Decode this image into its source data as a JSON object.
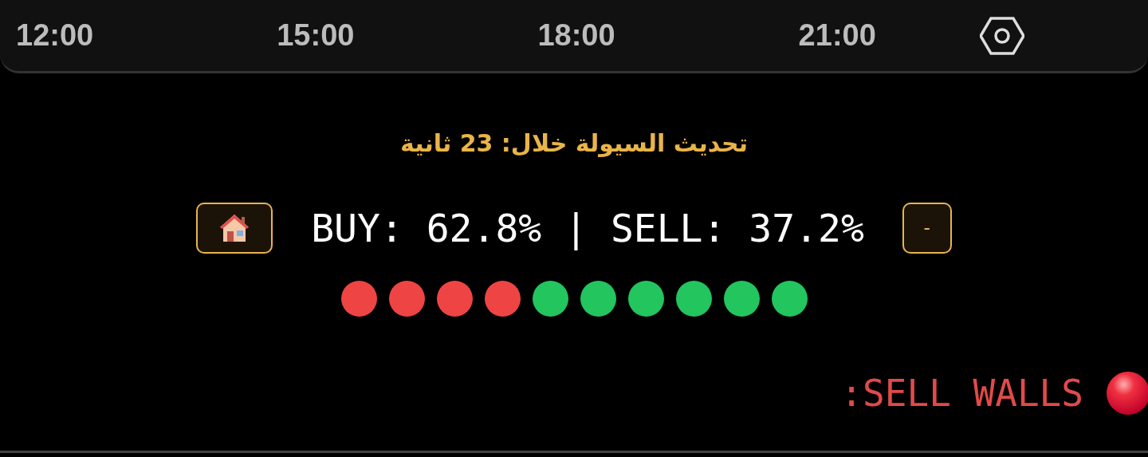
{
  "timeline": {
    "hours": [
      "12:00",
      "15:00",
      "18:00",
      "21:00"
    ]
  },
  "refresh_notice": "تحديث السيولة خلال: 23 ثانية",
  "ratio": {
    "text": "BUY: 62.8% | SELL: 37.2%",
    "minus_button": "-"
  },
  "dots": [
    {
      "color": "#ef4444"
    },
    {
      "color": "#ef4444"
    },
    {
      "color": "#ef4444"
    },
    {
      "color": "#ef4444"
    },
    {
      "color": "#22c55e"
    },
    {
      "color": "#22c55e"
    },
    {
      "color": "#22c55e"
    },
    {
      "color": "#22c55e"
    },
    {
      "color": "#22c55e"
    },
    {
      "color": "#22c55e"
    }
  ],
  "walls": {
    "label": ":SELL WALLS"
  }
}
